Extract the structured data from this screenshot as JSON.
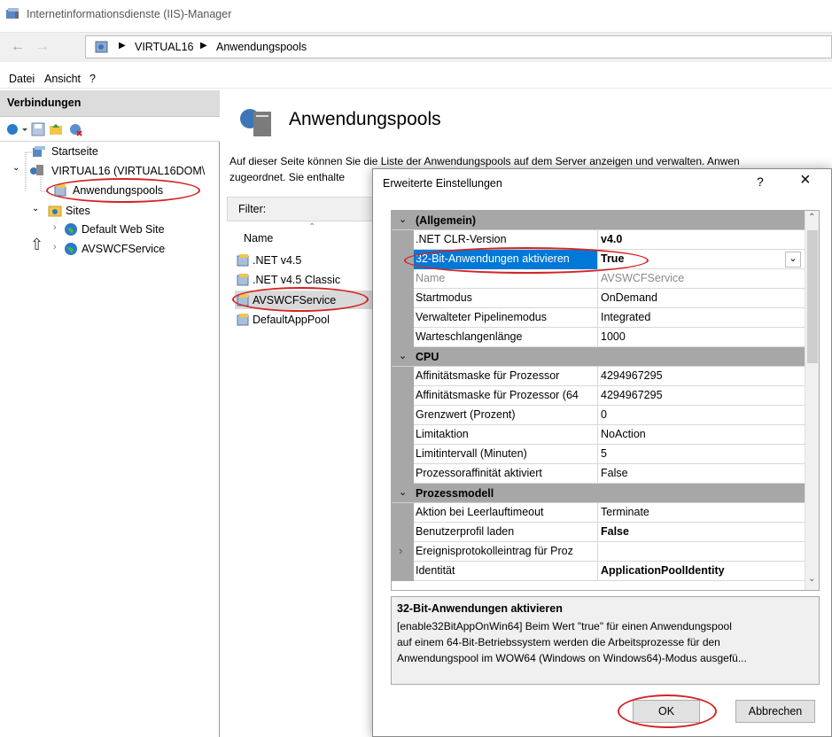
{
  "window": {
    "title": "Internetinformationsdienste (IIS)-Manager"
  },
  "breadcrumb": {
    "items": [
      "VIRTUAL16",
      "Anwendungspools"
    ]
  },
  "menu": {
    "items": [
      "Datei",
      "Ansicht",
      "?"
    ]
  },
  "connections": {
    "header": "Verbindungen",
    "tree": {
      "start": "Startseite",
      "server": "VIRTUAL16 (VIRTUAL16DOM\\",
      "app_pools": "Anwendungspools",
      "sites": "Sites",
      "site1": "Default Web Site",
      "site2": "AVSWCFService"
    }
  },
  "main": {
    "title": "Anwendungspools",
    "desc_line1": "Auf dieser Seite können Sie die Liste der Anwendungspools auf dem Server anzeigen und verwalten. Anwen",
    "desc_line2": "zugeordnet. Sie enthalte",
    "filter_label": "Filter:",
    "col_name": "Name",
    "pools": [
      ".NET v4.5",
      ".NET v4.5 Classic",
      "AVSWCFService",
      "DefaultAppPool"
    ]
  },
  "dialog": {
    "title": "Erweiterte Einstellungen",
    "help": "?",
    "close": "×",
    "categories": {
      "general": "(Allgemein)",
      "cpu": "CPU",
      "process_model": "Prozessmodell"
    },
    "general": [
      {
        "name": ".NET CLR-Version",
        "value": "v4.0"
      },
      {
        "name": "32-Bit-Anwendungen aktivieren",
        "value": "True"
      },
      {
        "name": "Name",
        "value": "AVSWCFService"
      },
      {
        "name": "Startmodus",
        "value": "OnDemand"
      },
      {
        "name": "Verwalteter Pipelinemodus",
        "value": "Integrated"
      },
      {
        "name": "Warteschlangenlänge",
        "value": "1000"
      }
    ],
    "cpu": [
      {
        "name": "Affinitätsmaske für Prozessor",
        "value": "4294967295"
      },
      {
        "name": "Affinitätsmaske für Prozessor (64",
        "value": "4294967295"
      },
      {
        "name": "Grenzwert (Prozent)",
        "value": "0"
      },
      {
        "name": "Limitaktion",
        "value": "NoAction"
      },
      {
        "name": "Limitintervall (Minuten)",
        "value": "5"
      },
      {
        "name": "Prozessoraffinität aktiviert",
        "value": "False"
      }
    ],
    "process_model": [
      {
        "name": "Aktion bei Leerlauftimeout",
        "value": "Terminate"
      },
      {
        "name": "Benutzerprofil laden",
        "value": "False"
      },
      {
        "name": "Ereignisprotokolleintrag für Proz",
        "value": ""
      },
      {
        "name": "Identität",
        "value": "ApplicationPoolIdentity"
      }
    ],
    "description": {
      "title": "32-Bit-Anwendungen aktivieren",
      "line1": "[enable32BitAppOnWin64] Beim Wert \"true\" für einen Anwendungspool",
      "line2": "auf einem 64-Bit-Betriebssystem werden die Arbeitsprozesse für den",
      "line3": "Anwendungspool im WOW64 (Windows on Windows64)-Modus ausgefü..."
    },
    "ok": "OK",
    "cancel": "Abbrechen"
  }
}
